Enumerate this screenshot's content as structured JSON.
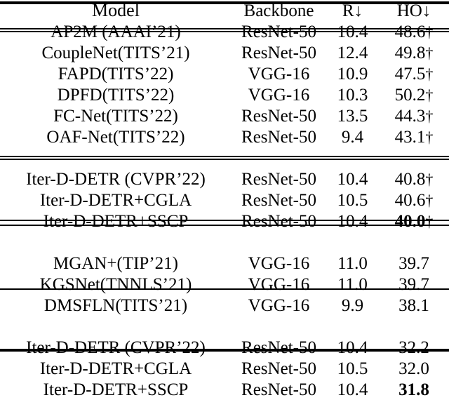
{
  "table": {
    "columns": [
      {
        "key": "model",
        "label": "Model"
      },
      {
        "key": "backbone",
        "label": "Backbone"
      },
      {
        "key": "r",
        "label": "R",
        "arrow": "↓"
      },
      {
        "key": "ho",
        "label": "HO",
        "arrow": "↓"
      }
    ],
    "header": {
      "model": "Model",
      "backbone": "Backbone",
      "r": "R↓",
      "ho": "HO↓"
    },
    "dagger_symbol": "†",
    "sections": [
      {
        "id": "section-1",
        "rows": [
          {
            "model": "AP2M (AAAI’21)",
            "backbone": "ResNet-50",
            "r": "10.4",
            "ho": "48.6",
            "ho_dagger": true,
            "ho_bold": false
          },
          {
            "model": "CoupleNet(TITS’21)",
            "backbone": "ResNet-50",
            "r": "12.4",
            "ho": "49.8",
            "ho_dagger": true,
            "ho_bold": false
          },
          {
            "model": "FAPD(TITS’22)",
            "backbone": "VGG-16",
            "r": "10.9",
            "ho": "47.5",
            "ho_dagger": true,
            "ho_bold": false
          },
          {
            "model": "DPFD(TITS’22)",
            "backbone": "VGG-16",
            "r": "10.3",
            "ho": "50.2",
            "ho_dagger": true,
            "ho_bold": false
          },
          {
            "model": "FC-Net(TITS’22)",
            "backbone": "ResNet-50",
            "r": "13.5",
            "ho": "44.3",
            "ho_dagger": true,
            "ho_bold": false
          },
          {
            "model": "OAF-Net(TITS’22)",
            "backbone": "ResNet-50",
            "r": "9.4",
            "ho": "43.1",
            "ho_dagger": true,
            "ho_bold": false
          }
        ]
      },
      {
        "id": "section-2",
        "rows": [
          {
            "model": "Iter-D-DETR (CVPR’22)",
            "backbone": "ResNet-50",
            "r": "10.4",
            "ho": "40.8",
            "ho_dagger": true,
            "ho_bold": false
          },
          {
            "model": "Iter-D-DETR+CGLA",
            "backbone": "ResNet-50",
            "r": "10.5",
            "ho": "40.6",
            "ho_dagger": true,
            "ho_bold": false
          },
          {
            "model": "Iter-D-DETR+SSCP",
            "backbone": "ResNet-50",
            "r": "10.4",
            "ho": "40.0",
            "ho_dagger": true,
            "ho_bold": true
          }
        ]
      },
      {
        "id": "section-3",
        "rows": [
          {
            "model": "MGAN+(TIP’21)",
            "backbone": "VGG-16",
            "r": "11.0",
            "ho": "39.7",
            "ho_dagger": false,
            "ho_bold": false
          },
          {
            "model": "KGSNet(TNNLS’21)",
            "backbone": "VGG-16",
            "r": "11.0",
            "ho": "39.7",
            "ho_dagger": false,
            "ho_bold": false
          },
          {
            "model": "DMSFLN(TITS’21)",
            "backbone": "VGG-16",
            "r": "9.9",
            "ho": "38.1",
            "ho_dagger": false,
            "ho_bold": false
          }
        ]
      },
      {
        "id": "section-4",
        "rows": [
          {
            "model": "Iter-D-DETR (CVPR’22)",
            "backbone": "ResNet-50",
            "r": "10.4",
            "ho": "32.2",
            "ho_dagger": false,
            "ho_bold": false
          },
          {
            "model": "Iter-D-DETR+CGLA",
            "backbone": "ResNet-50",
            "r": "10.5",
            "ho": "32.0",
            "ho_dagger": false,
            "ho_bold": false
          },
          {
            "model": "Iter-D-DETR+SSCP",
            "backbone": "ResNet-50",
            "r": "10.4",
            "ho": "31.8",
            "ho_dagger": false,
            "ho_bold": true
          }
        ]
      }
    ]
  }
}
